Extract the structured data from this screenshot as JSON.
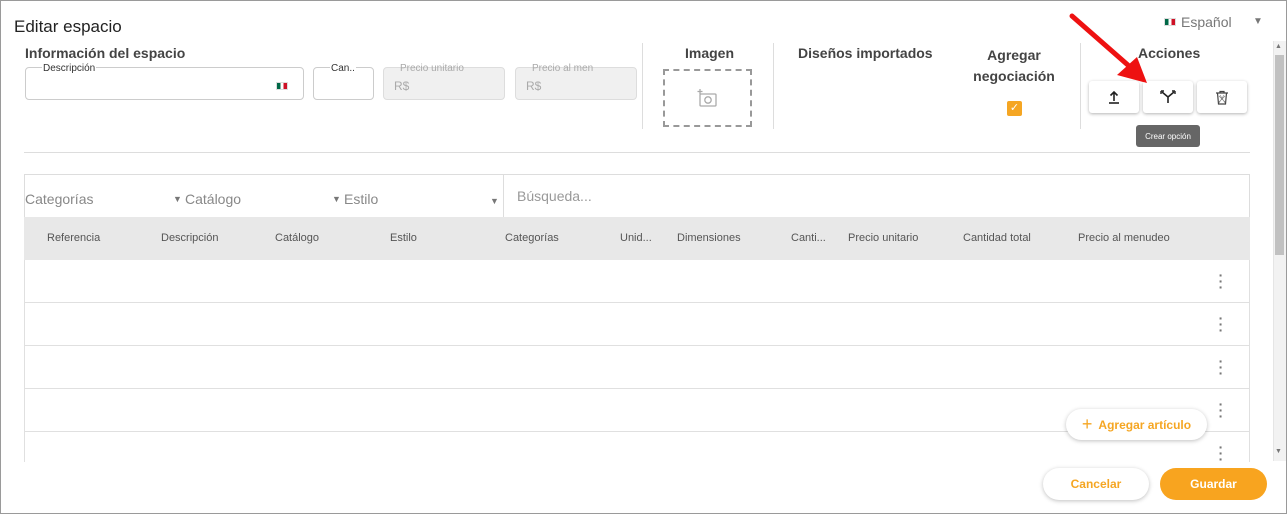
{
  "dialog": {
    "title": "Editar espacio",
    "language": {
      "label": "Español",
      "flag_icon": "mexico-flag-icon"
    }
  },
  "info": {
    "heading": "Información del espacio",
    "description": {
      "label": "Descripción",
      "value": "",
      "flag_icon": "mexico-flag-icon"
    },
    "quantity": {
      "label": "Can..",
      "value": ""
    },
    "unit_price": {
      "label": "Precio unitario",
      "value": "R$"
    },
    "retail_price": {
      "label": "Precio al men",
      "value": "R$"
    }
  },
  "image": {
    "heading": "Imagen",
    "upload_icon": "add-photo-icon"
  },
  "designs": {
    "heading": "Diseños importados"
  },
  "negotiation": {
    "heading_line1": "Agregar",
    "heading_line2": "negociación",
    "checked": true
  },
  "actions": {
    "heading": "Acciones",
    "buttons": [
      {
        "icon": "upload-icon"
      },
      {
        "icon": "create-option-icon",
        "tooltip": "Crear opción"
      },
      {
        "icon": "trash-icon"
      }
    ]
  },
  "filters": {
    "categories": "Categorías",
    "catalog": "Catálogo",
    "style": "Estilo",
    "search_placeholder": "Búsqueda..."
  },
  "table": {
    "columns": [
      "Referencia",
      "Descripción",
      "Catálogo",
      "Estilo",
      "Categorías",
      "Unid...",
      "Dimensiones",
      "Canti...",
      "Precio unitario",
      "Cantidad total",
      "Precio al menudeo"
    ],
    "rows": [
      {},
      {},
      {},
      {},
      {}
    ]
  },
  "footer": {
    "add_item": "Agregar artículo",
    "cancel": "Cancelar",
    "save": "Guardar"
  },
  "colors": {
    "accent": "#f8a41f",
    "header_bg": "#e8e8e8"
  }
}
